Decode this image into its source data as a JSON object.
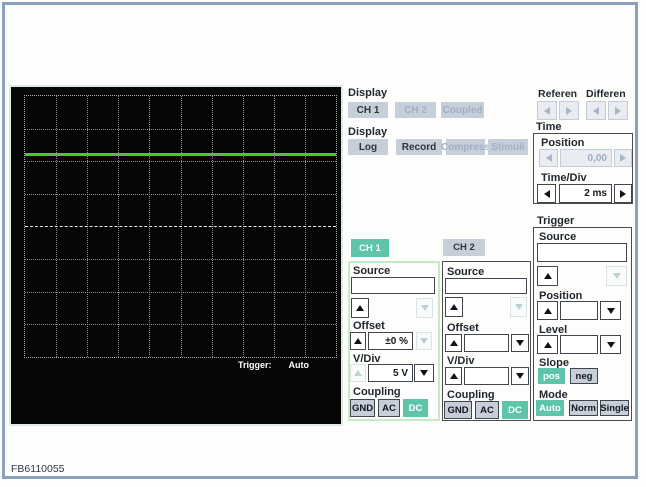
{
  "window": {
    "footer_code": "FB6110055"
  },
  "scope": {
    "trigger_status_label": "Trigger:",
    "trigger_status_value": "Auto"
  },
  "display_channel_section": {
    "title": "Display",
    "buttons": [
      {
        "label": "CH 1",
        "enabled": true
      },
      {
        "label": "CH 2",
        "enabled": false
      },
      {
        "label": "Coupled",
        "enabled": false
      }
    ]
  },
  "display_mode_section": {
    "title": "Display",
    "buttons": [
      {
        "label": "Log",
        "enabled": true
      },
      {
        "label": "Record",
        "enabled": true
      },
      {
        "label": "Compress",
        "enabled": false
      },
      {
        "label": "Stimuli",
        "enabled": false
      }
    ]
  },
  "reference_section": {
    "reference_label": "Referen",
    "difference_label": "Differen"
  },
  "time_section": {
    "title": "Time",
    "position_label": "Position",
    "position_value": "0,00",
    "time_div_label": "Time/Div",
    "time_div_value": "2 ms"
  },
  "trigger_section": {
    "title": "Trigger",
    "source_label": "Source",
    "source_value": "",
    "position_label": "Position",
    "position_value": "",
    "level_label": "Level",
    "level_value": "",
    "slope_label": "Slope",
    "slope_options": [
      {
        "label": "pos",
        "selected": true
      },
      {
        "label": "neg",
        "selected": false
      }
    ],
    "mode_label": "Mode",
    "mode_options": [
      {
        "label": "Auto",
        "selected": true
      },
      {
        "label": "Norm",
        "selected": false
      },
      {
        "label": "Single",
        "selected": false
      }
    ]
  },
  "channel1": {
    "tab_label": "CH 1",
    "tab_selected": true,
    "source_label": "Source",
    "source_value": "",
    "offset_label": "Offset",
    "offset_value": "±0 %",
    "vdiv_label": "V/Div",
    "vdiv_value": "5 V",
    "coupling_label": "Coupling",
    "coupling_options": [
      {
        "label": "GND",
        "selected": false
      },
      {
        "label": "AC",
        "selected": false
      },
      {
        "label": "DC",
        "selected": true
      }
    ]
  },
  "channel2": {
    "tab_label": "CH 2",
    "tab_selected": false,
    "source_label": "Source",
    "source_value": "",
    "offset_label": "Offset",
    "offset_value": "",
    "vdiv_label": "V/Div",
    "vdiv_value": "",
    "coupling_label": "Coupling",
    "coupling_options": [
      {
        "label": "GND",
        "selected": false
      },
      {
        "label": "AC",
        "selected": false
      },
      {
        "label": "DC",
        "selected": true
      }
    ]
  },
  "colors": {
    "accent_teal": "#5ec5ab",
    "frame_border": "#8aa1b9",
    "trace_green": "#4ec43a",
    "button_gray": "#c6ceda"
  }
}
